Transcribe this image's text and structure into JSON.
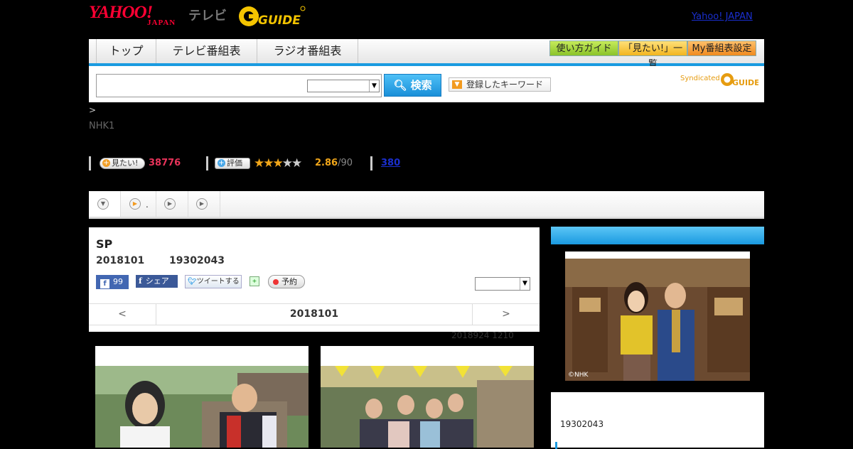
{
  "header": {
    "logo_yahoo": "YAHOO!",
    "logo_japan": "JAPAN",
    "logo_tv": "テレビ",
    "logo_gguide": "G-GUIDE",
    "yahoo_japan_link": "Yahoo! JAPAN"
  },
  "nav": {
    "tabs": [
      "トップ",
      "テレビ番組表",
      "ラジオ番組表"
    ],
    "guide_buttons": [
      "使い方ガイド",
      "「見たい!」一覧",
      "My番組表設定"
    ]
  },
  "search": {
    "input_value": "",
    "select_value": "",
    "search_button": "検索",
    "keyword_button": "登録したキーワード",
    "syndicated": "Syndicated"
  },
  "breadcrumb": ">",
  "channel": "NHK1",
  "stats": {
    "mitai_label": "見たい!",
    "mitai_count": "38776",
    "hyoka_label": "評価",
    "rating_value": "2.86",
    "rating_suffix": "/90",
    "stars": 2.5,
    "review_link": "380"
  },
  "tabs": [
    {
      "icon": "chevron-down-icon"
    },
    {
      "icon": "play-icon",
      "label": "."
    },
    {
      "icon": "play-icon"
    },
    {
      "icon": "play-icon"
    }
  ],
  "program": {
    "title": "SP",
    "date": "2018101",
    "time": "19302043",
    "fb_like_count": "99",
    "fb_share": "シェア",
    "tweet": "ツイートする",
    "reserve": "予約",
    "select_value": "",
    "nav_prev": "<",
    "nav_current": "2018101",
    "nav_next": ">",
    "updated": "2018924  1210"
  },
  "side": {
    "photo_credit": "©NHK",
    "time": "19302043"
  },
  "colors": {
    "accent_blue": "#1a9ae0",
    "count_red": "#e8335a",
    "star_orange": "#f2a71a",
    "link_blue": "#1a2fcf"
  }
}
